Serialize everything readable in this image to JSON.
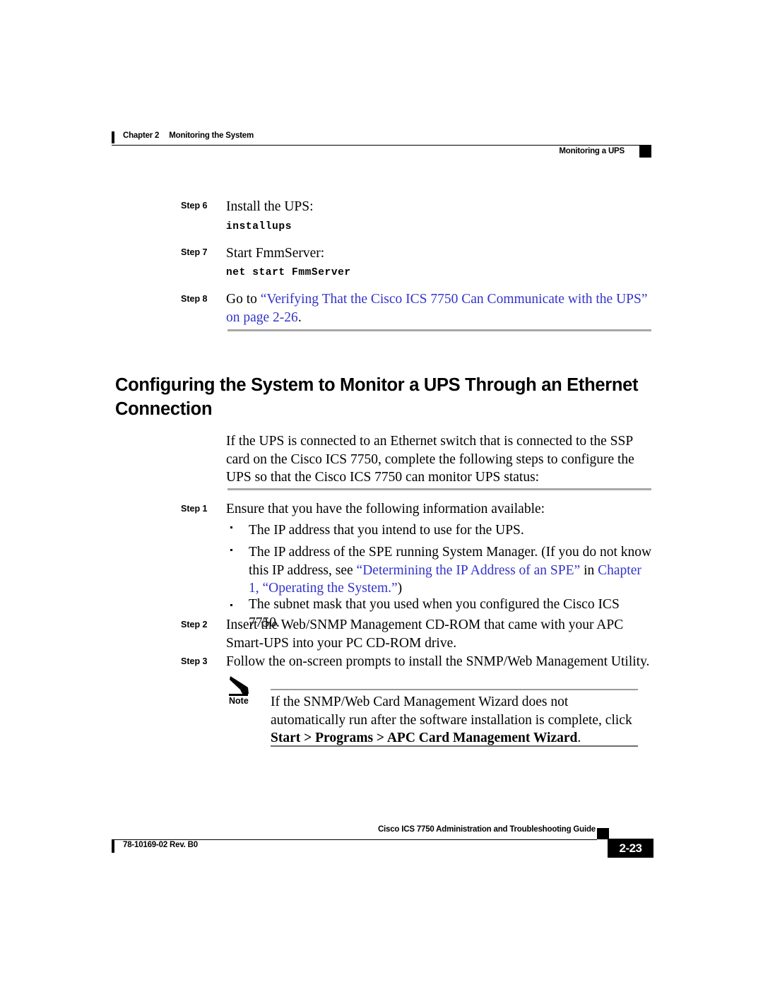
{
  "header": {
    "chapter_label": "Chapter 2",
    "chapter_title": "Monitoring the System",
    "running_head_right": "Monitoring a UPS"
  },
  "steps_top": [
    {
      "label": "Step 6",
      "text": "Install the UPS:",
      "code": "installups"
    },
    {
      "label": "Step 7",
      "text": "Start FmmServer:",
      "code": "net start FmmServer"
    },
    {
      "label": "Step 8",
      "text_prefix": "Go to ",
      "link_text": "“Verifying That the Cisco ICS 7750 Can Communicate with the UPS” on page 2-26",
      "text_suffix": "."
    }
  ],
  "section": {
    "heading": "Configuring the System to Monitor a UPS Through an Ethernet Connection",
    "intro": "If the UPS is connected to an Ethernet switch that is connected to the SSP card on the Cisco ICS 7750, complete the following steps to configure the UPS so that the Cisco ICS 7750 can monitor UPS status:"
  },
  "steps_main": [
    {
      "label": "Step 1",
      "text": "Ensure that you have the following information available:"
    },
    {
      "label": "Step 2",
      "text": "Insert the Web/SNMP Management CD-ROM that came with your APC Smart-UPS into your PC CD-ROM drive."
    },
    {
      "label": "Step 3",
      "text": "Follow the on-screen prompts to install the SNMP/Web Management Utility."
    }
  ],
  "bullets": [
    {
      "text": "The IP address that you intend to use for the UPS."
    },
    {
      "prefix": "The IP address of the SPE running System Manager. (If you do not know this IP address, see ",
      "link1": "“Determining the IP Address of an SPE”",
      "mid": " in ",
      "link2": "Chapter 1, “Operating the System.”",
      "suffix": ")"
    },
    {
      "text": "The subnet mask that you used when you configured the Cisco ICS 7750."
    }
  ],
  "note": {
    "label": "Note",
    "icon": "pencil-icon",
    "text_prefix": "If the SNMP/Web Card Management Wizard does not automatically run after the software installation is complete, click ",
    "bold_text": "Start > Programs > APC Card Management Wizard",
    "text_suffix": "."
  },
  "footer": {
    "guide_title": "Cisco ICS 7750 Administration and Troubleshooting Guide",
    "doc_number": "78-10169-02 Rev. B0",
    "page_number": "2-23"
  },
  "colors": {
    "link": "#3333cc",
    "rule_gray": "#a8a8a8",
    "black": "#000000"
  }
}
